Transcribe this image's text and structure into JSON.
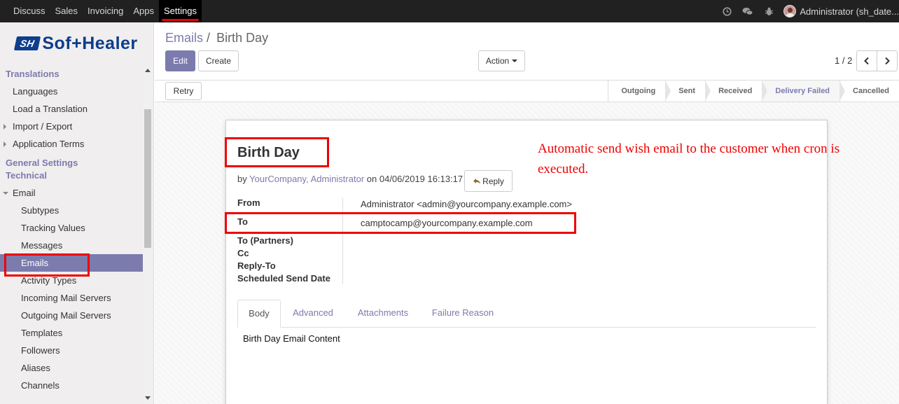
{
  "topbar": {
    "menu": [
      "Discuss",
      "Sales",
      "Invoicing",
      "Apps",
      "Settings"
    ],
    "active": "Settings",
    "user": "Administrator (sh_date..."
  },
  "sidebar": {
    "logo_text": "Sof+Healer",
    "logo_mark": "SH",
    "sections": {
      "translations": "Translations",
      "general_settings": "General Settings",
      "technical": "Technical"
    },
    "translations_items": [
      "Languages",
      "Load a Translation",
      "Import / Export",
      "Application Terms"
    ],
    "email_group": "Email",
    "email_items": [
      "Subtypes",
      "Tracking Values",
      "Messages",
      "Emails",
      "Activity Types",
      "Incoming Mail Servers",
      "Outgoing Mail Servers",
      "Templates",
      "Followers",
      "Aliases",
      "Channels"
    ],
    "active_item": "Emails"
  },
  "control": {
    "breadcrumb_parent": "Emails",
    "breadcrumb_sep": "/",
    "breadcrumb_current": "Birth Day",
    "edit_label": "Edit",
    "create_label": "Create",
    "action_label": "Action",
    "pager": "1 / 2"
  },
  "statusbar": {
    "retry_label": "Retry",
    "stages": [
      "Outgoing",
      "Sent",
      "Received",
      "Delivery Failed",
      "Cancelled"
    ],
    "active_stage": "Delivery Failed"
  },
  "sheet": {
    "title": "Birth Day",
    "by_prefix": "by",
    "author": "YourCompany, Administrator",
    "on_text": "on 04/06/2019 16:13:17",
    "reply_label": "Reply",
    "annotation": "Automatic send wish email to the customer when cron is executed.",
    "fields": [
      {
        "label": "From",
        "value": "Administrator <admin@yourcompany.example.com>"
      },
      {
        "label": "To",
        "value": "camptocamp@yourcompany.example.com"
      },
      {
        "label": "To (Partners)",
        "value": ""
      },
      {
        "label": "Cc",
        "value": ""
      },
      {
        "label": "Reply-To",
        "value": ""
      },
      {
        "label": "Scheduled Send Date",
        "value": ""
      }
    ],
    "tabs": [
      "Body",
      "Advanced",
      "Attachments",
      "Failure Reason"
    ],
    "active_tab": "Body",
    "body_content": "Birth Day Email Content"
  },
  "colors": {
    "accent": "#7c7bad",
    "annotation_red": "#e00000",
    "topbar_bg": "#212121"
  }
}
